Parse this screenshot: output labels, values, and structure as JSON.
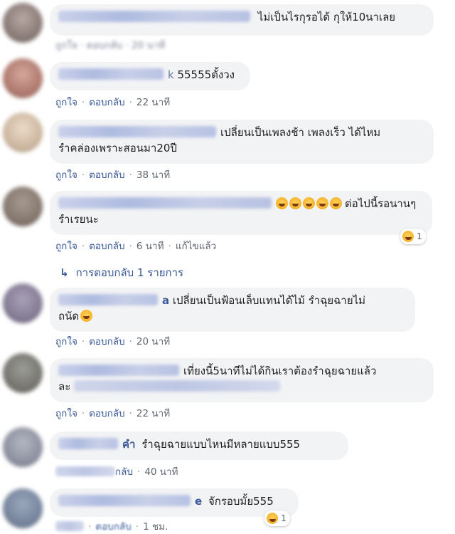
{
  "comments": [
    {
      "text": "ไม่เป็นไรกุรอได้ กุให้10นาเลย",
      "actions_blurred": "ถูกใจ · ตอบกลับ · 20 นาที"
    },
    {
      "name_tail": "k",
      "text": "55555ตั้งวง",
      "like": "ถูกใจ",
      "reply": "ตอบกลับ",
      "time": "22 นาที"
    },
    {
      "text": "เปลี่ยนเป็นเพลงช้า เพลงเร็ว ได้ไหม",
      "text2": "รำคล่องเพราะสอนมา20ปี",
      "like": "ถูกใจ",
      "reply": "ตอบกลับ",
      "time": "38 นาที"
    },
    {
      "text": "ต่อไปนี้รอนานๆ",
      "text2": "รำเรยนะ",
      "like": "ถูกใจ",
      "reply": "ตอบกลับ",
      "time": "6 นาที",
      "edited": "แก้ไขแล้ว",
      "reaction_count": "1",
      "replies_label": "การตอบกลับ 1 รายการ"
    },
    {
      "name_tail": "a",
      "text": "เปลี่ยนเป็นฟ้อนเล็บแทนได้ไม้ รำฉุยฉายไม่",
      "text2": "ถนัด",
      "like": "ถูกใจ",
      "reply": "ตอบกลับ",
      "time": "20 นาที"
    },
    {
      "text": "เที่ยงนี้5นาทีไม่ได้กินเราต้องรำฉุยฉายแล้ว",
      "text2_prefix": "ละ",
      "like": "ถูกใจ",
      "reply": "ตอบกลับ",
      "time": "22 นาที"
    },
    {
      "name_tail": "คำ",
      "text": "รำฉุยฉายแบบไหนมีหลายแบบ555",
      "reply_partial": "กลับ",
      "time": "40 นาที"
    },
    {
      "name_tail": "e",
      "text": "จักรอบมั้ย555",
      "reply_partial": "ตอบกลับ",
      "time": "1 ชม.",
      "reaction_count": "1"
    }
  ]
}
